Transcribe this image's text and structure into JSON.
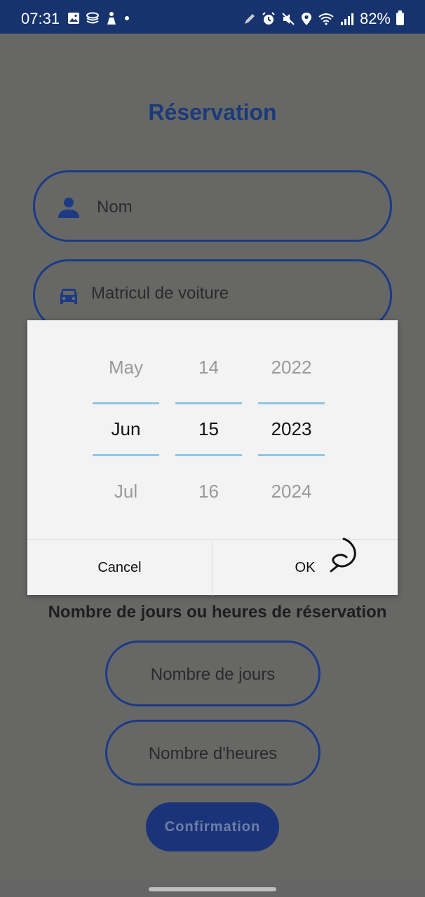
{
  "status_bar": {
    "time": "07:31",
    "battery": "82%",
    "left_icons": [
      "image-icon",
      "stack-icon",
      "figure-icon",
      "dot-icon"
    ],
    "right_icons": [
      "pen-icon",
      "alarm-icon",
      "mute-icon",
      "location-icon",
      "wifi-icon",
      "signal-icon",
      "battery-icon"
    ]
  },
  "page": {
    "title": "Réservation",
    "name_field": {
      "placeholder": "Nom",
      "icon": "person-icon"
    },
    "plate_field": {
      "placeholder": "Matricul de voiture",
      "icon": "car-icon"
    },
    "duration_label": "Nombre de jours ou heures de réservation",
    "days_field": {
      "placeholder": "Nombre de jours"
    },
    "hours_field": {
      "placeholder": "Nombre d'heures"
    },
    "confirm_label": "Confirmation"
  },
  "date_picker": {
    "month": {
      "prev": "May",
      "selected": "Jun",
      "next": "Jul"
    },
    "day": {
      "prev": "14",
      "selected": "15",
      "next": "16"
    },
    "year": {
      "prev": "2022",
      "selected": "2023",
      "next": "2024"
    },
    "cancel_label": "Cancel",
    "ok_label": "OK"
  },
  "colors": {
    "status_bar": "#16336e",
    "accent": "#1c3a86",
    "scrim": "#676866",
    "dialog": "#f3f3f3",
    "selection_line": "#8fc7e2"
  }
}
